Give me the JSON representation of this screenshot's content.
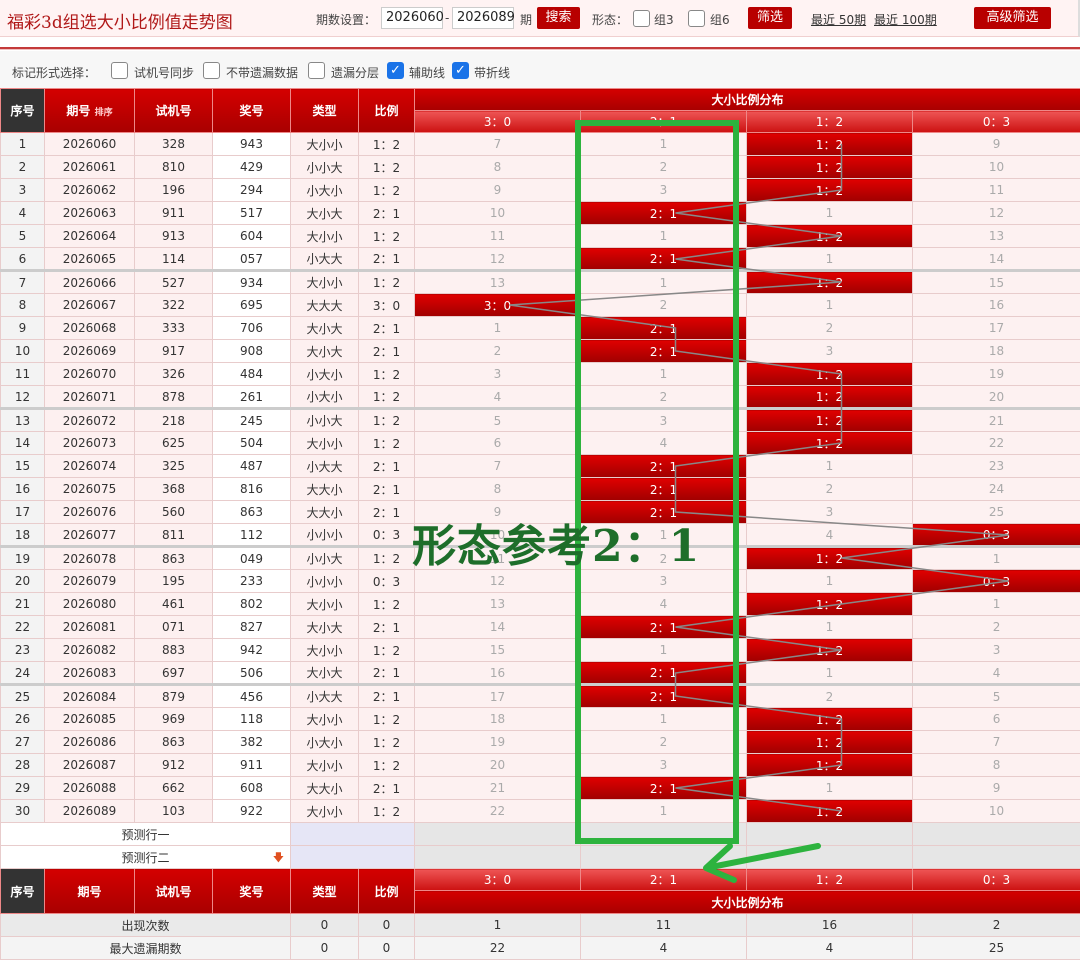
{
  "title": "福彩3d组选大小比例值走势图",
  "toolbar": {
    "period_label": "期数设置：",
    "from": "2026060",
    "to": "2026089",
    "period_unit": "期",
    "search": "搜索",
    "form_label": "形态：",
    "group3": "组3",
    "group6": "组6",
    "filter": "筛选",
    "recent50": "最近 50期",
    "recent100": "最近 100期",
    "advanced": "高级筛选"
  },
  "options": {
    "label": "标记形式选择：",
    "items": [
      {
        "label": "试机号同步",
        "checked": false
      },
      {
        "label": "不带遗漏数据",
        "checked": false
      },
      {
        "label": "遗漏分层",
        "checked": false
      },
      {
        "label": "辅助线",
        "checked": true
      },
      {
        "label": "带折线",
        "checked": true
      }
    ]
  },
  "headers": {
    "seq": "序号",
    "period": "期号",
    "sort": "排序",
    "test": "试机号",
    "prize": "奖号",
    "type": "类型",
    "ratio": "比例",
    "dist": "大小比例分布",
    "dist_cols": [
      "3：0",
      "2：1",
      "1：2",
      "0：3"
    ]
  },
  "rows": [
    [
      "1",
      "2026060",
      "328",
      "943",
      "大小小",
      "1：2",
      [
        "7",
        "1",
        "1：2",
        "9"
      ]
    ],
    [
      "2",
      "2026061",
      "810",
      "429",
      "小小大",
      "1：2",
      [
        "8",
        "2",
        "1：2",
        "10"
      ]
    ],
    [
      "3",
      "2026062",
      "196",
      "294",
      "小大小",
      "1：2",
      [
        "9",
        "3",
        "1：2",
        "11"
      ]
    ],
    [
      "4",
      "2026063",
      "911",
      "517",
      "大小大",
      "2：1",
      [
        "10",
        "2：1",
        "1",
        "12"
      ]
    ],
    [
      "5",
      "2026064",
      "913",
      "604",
      "大小小",
      "1：2",
      [
        "11",
        "1",
        "1：2",
        "13"
      ]
    ],
    [
      "6",
      "2026065",
      "114",
      "057",
      "小大大",
      "2：1",
      [
        "12",
        "2：1",
        "1",
        "14"
      ]
    ],
    [
      "7",
      "2026066",
      "527",
      "934",
      "大小小",
      "1：2",
      [
        "13",
        "1",
        "1：2",
        "15"
      ]
    ],
    [
      "8",
      "2026067",
      "322",
      "695",
      "大大大",
      "3：0",
      [
        "3：0",
        "2",
        "1",
        "16"
      ]
    ],
    [
      "9",
      "2026068",
      "333",
      "706",
      "大小大",
      "2：1",
      [
        "1",
        "2：1",
        "2",
        "17"
      ]
    ],
    [
      "10",
      "2026069",
      "917",
      "908",
      "大小大",
      "2：1",
      [
        "2",
        "2：1",
        "3",
        "18"
      ]
    ],
    [
      "11",
      "2026070",
      "326",
      "484",
      "小大小",
      "1：2",
      [
        "3",
        "1",
        "1：2",
        "19"
      ]
    ],
    [
      "12",
      "2026071",
      "878",
      "261",
      "小大小",
      "1：2",
      [
        "4",
        "2",
        "1：2",
        "20"
      ]
    ],
    [
      "13",
      "2026072",
      "218",
      "245",
      "小小大",
      "1：2",
      [
        "5",
        "3",
        "1：2",
        "21"
      ]
    ],
    [
      "14",
      "2026073",
      "625",
      "504",
      "大小小",
      "1：2",
      [
        "6",
        "4",
        "1：2",
        "22"
      ]
    ],
    [
      "15",
      "2026074",
      "325",
      "487",
      "小大大",
      "2：1",
      [
        "7",
        "2：1",
        "1",
        "23"
      ]
    ],
    [
      "16",
      "2026075",
      "368",
      "816",
      "大大小",
      "2：1",
      [
        "8",
        "2：1",
        "2",
        "24"
      ]
    ],
    [
      "17",
      "2026076",
      "560",
      "863",
      "大大小",
      "2：1",
      [
        "9",
        "2：1",
        "3",
        "25"
      ]
    ],
    [
      "18",
      "2026077",
      "811",
      "112",
      "小小小",
      "0：3",
      [
        "10",
        "1",
        "4",
        "0：3"
      ]
    ],
    [
      "19",
      "2026078",
      "863",
      "049",
      "小小大",
      "1：2",
      [
        "11",
        "2",
        "1：2",
        "1"
      ]
    ],
    [
      "20",
      "2026079",
      "195",
      "233",
      "小小小",
      "0：3",
      [
        "12",
        "3",
        "1",
        "0：3"
      ]
    ],
    [
      "21",
      "2026080",
      "461",
      "802",
      "大小小",
      "1：2",
      [
        "13",
        "4",
        "1：2",
        "1"
      ]
    ],
    [
      "22",
      "2026081",
      "071",
      "827",
      "大小大",
      "2：1",
      [
        "14",
        "2：1",
        "1",
        "2"
      ]
    ],
    [
      "23",
      "2026082",
      "883",
      "942",
      "大小小",
      "1：2",
      [
        "15",
        "1",
        "1：2",
        "3"
      ]
    ],
    [
      "24",
      "2026083",
      "697",
      "506",
      "大小大",
      "2：1",
      [
        "16",
        "2：1",
        "1",
        "4"
      ]
    ],
    [
      "25",
      "2026084",
      "879",
      "456",
      "小大大",
      "2：1",
      [
        "17",
        "2：1",
        "2",
        "5"
      ]
    ],
    [
      "26",
      "2026085",
      "969",
      "118",
      "大小小",
      "1：2",
      [
        "18",
        "1",
        "1：2",
        "6"
      ]
    ],
    [
      "27",
      "2026086",
      "863",
      "382",
      "小大小",
      "1：2",
      [
        "19",
        "2",
        "1：2",
        "7"
      ]
    ],
    [
      "28",
      "2026087",
      "912",
      "911",
      "大小小",
      "1：2",
      [
        "20",
        "3",
        "1：2",
        "8"
      ]
    ],
    [
      "29",
      "2026088",
      "662",
      "608",
      "大大小",
      "2：1",
      [
        "21",
        "2：1",
        "1",
        "9"
      ]
    ],
    [
      "30",
      "2026089",
      "103",
      "922",
      "大小小",
      "1：2",
      [
        "22",
        "1",
        "1：2",
        "10"
      ]
    ]
  ],
  "predict": [
    "预测行一",
    "预测行二"
  ],
  "stats": [
    {
      "label": "出现次数",
      "values": [
        "0",
        "0",
        "1",
        "11",
        "16",
        "2"
      ]
    },
    {
      "label": "最大遗漏期数",
      "values": [
        "0",
        "0",
        "22",
        "4",
        "4",
        "25"
      ]
    }
  ],
  "annotation": {
    "text": "形态参考2：1",
    "color": "#2db33e"
  },
  "colors": {
    "accent": "#c00000",
    "check": "#1a73e8"
  }
}
